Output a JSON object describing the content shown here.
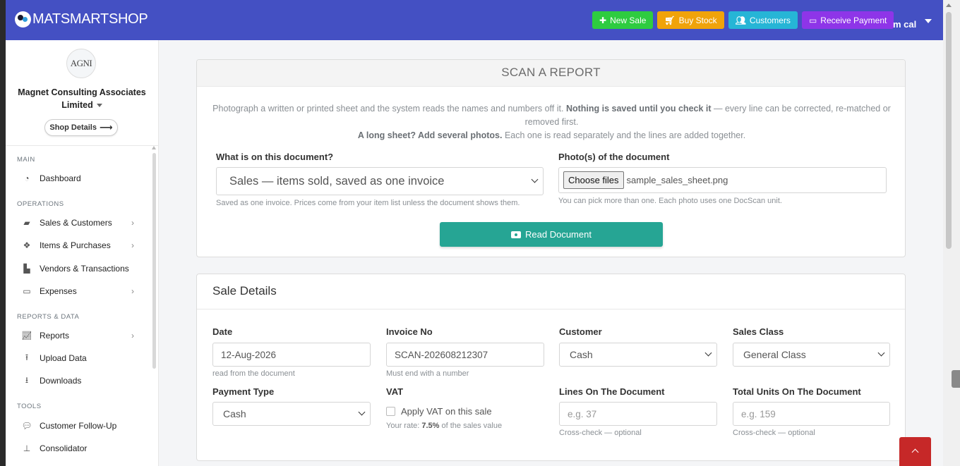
{
  "brand": {
    "name": "MATSMARTSHOP"
  },
  "topbar": {
    "new_sale": "New Sale",
    "buy_stock": "Buy Stock",
    "customers": "Customers",
    "receive_payment": "Receive Payment",
    "user": "m cal"
  },
  "sidebar": {
    "logo_text": "AGNI",
    "org_name": "Magnet Consulting Associates Limited",
    "shop_details": "Shop Details",
    "sections": {
      "main": "MAIN",
      "operations": "OPERATIONS",
      "reports": "REPORTS & DATA",
      "tools": "TOOLS"
    },
    "items": {
      "dashboard": "Dashboard",
      "sales_customers": "Sales & Customers",
      "items_purchases": "Items & Purchases",
      "vendors": "Vendors & Transactions",
      "expenses": "Expenses",
      "reports": "Reports",
      "upload_data": "Upload Data",
      "downloads": "Downloads",
      "follow_up": "Customer Follow-Up",
      "consolidator": "Consolidator"
    }
  },
  "scan": {
    "title": "SCAN A REPORT",
    "desc_line1_a": "Photograph a written or printed sheet and the system reads the names and numbers off it. ",
    "desc_line1_b": "Nothing is saved until you check it",
    "desc_line1_c": " — every line can be corrected, re-matched or removed first.",
    "desc_line2_a": "A long sheet? Add several photos.",
    "desc_line2_b": " Each one is read separately and the lines are added together.",
    "doc_label": "What is on this document?",
    "doc_value": "Sales — items sold, saved as one invoice",
    "doc_hint": "Saved as one invoice. Prices come from your item list unless the document shows them.",
    "photo_label": "Photo(s) of the document",
    "choose_files": "Choose files",
    "file_name": "sample_sales_sheet.png",
    "photo_hint": "You can pick more than one. Each photo uses one DocScan unit.",
    "read_button": "Read Document"
  },
  "sale": {
    "title": "Sale Details",
    "date_label": "Date",
    "date_value": "12-Aug-2026",
    "date_hint": "read from the document",
    "invoice_label": "Invoice No",
    "invoice_value": "SCAN-202608212307",
    "invoice_hint": "Must end with a number",
    "customer_label": "Customer",
    "customer_value": "Cash",
    "class_label": "Sales Class",
    "class_value": "General Class",
    "payment_label": "Payment Type",
    "payment_value": "Cash",
    "vat_label": "VAT",
    "vat_checkbox": "Apply VAT on this sale",
    "vat_rate_a": "Your rate: ",
    "vat_rate_b": "7.5%",
    "vat_rate_c": " of the sales value",
    "lines_label": "Lines On The Document",
    "lines_placeholder": "e.g. 37",
    "lines_hint": "Cross-check — optional",
    "units_label": "Total Units On The Document",
    "units_placeholder": "e.g. 159",
    "units_hint": "Cross-check — optional"
  },
  "colors": {
    "topbar": "#4450c3",
    "accent_teal": "#26a594",
    "back_to_top": "#c62828"
  }
}
